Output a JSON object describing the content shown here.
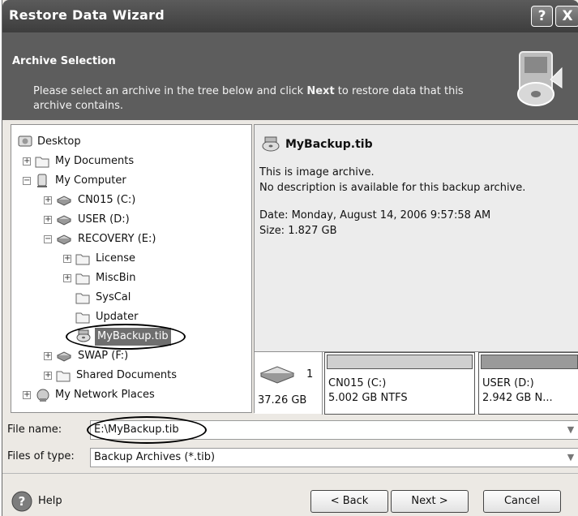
{
  "window": {
    "title": "Restore Data Wizard",
    "help_button": "?",
    "close_button": "X"
  },
  "header": {
    "title": "Archive Selection",
    "desc_before": "Please select an archive in the tree below and click ",
    "desc_bold": "Next",
    "desc_after": " to restore data that this archive contains."
  },
  "tree": {
    "items": [
      {
        "label": "Desktop"
      },
      {
        "label": "My Documents"
      },
      {
        "label": "My Computer"
      },
      {
        "label": "CN015 (C:)"
      },
      {
        "label": "USER (D:)"
      },
      {
        "label": "RECOVERY (E:)"
      },
      {
        "label": "License"
      },
      {
        "label": "MiscBin"
      },
      {
        "label": "SysCal"
      },
      {
        "label": "Updater"
      },
      {
        "label": "MyBackup.tib"
      },
      {
        "label": "SWAP (F:)"
      },
      {
        "label": "Shared Documents"
      },
      {
        "label": "My Network Places"
      }
    ],
    "selected": "MyBackup.tib"
  },
  "details": {
    "title": "MyBackup.tib",
    "line1": "This is image archive.",
    "line2": "No description is available for this backup archive.",
    "date": "Date: Monday, August 14, 2006 9:57:58 AM",
    "size": "Size: 1.827 GB"
  },
  "disk_map": {
    "disk_number": "1",
    "disk_size": "37.26 GB",
    "partitions": [
      {
        "name": "CN015 (C:)",
        "info": "5.002 GB  NTFS"
      },
      {
        "name": "USER (D:)",
        "info": "2.942 GB  N..."
      }
    ]
  },
  "file_name": {
    "label": "File name:",
    "value": "E:\\MyBackup.tib"
  },
  "file_type": {
    "label": "Files of type:",
    "value": "Backup Archives (*.tib)"
  },
  "buttons": {
    "help": "Help",
    "back": "< Back",
    "next": "Next >",
    "cancel": "Cancel"
  },
  "colors": {
    "header_bg": "#5d5d5d",
    "titlebar_bg": "#4a4a4a",
    "selection_bg": "#6e6e6e"
  }
}
